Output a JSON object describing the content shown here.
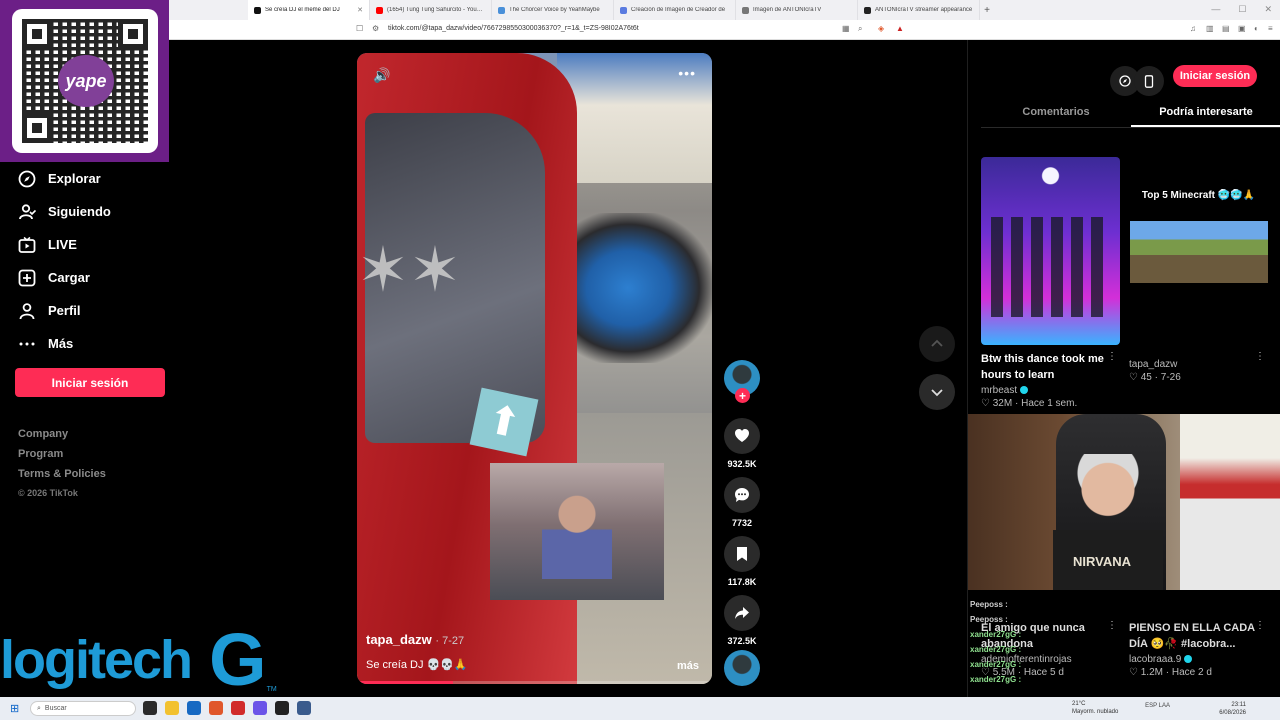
{
  "browser": {
    "tabs": [
      {
        "label": "Se creía DJ el meme del DJ",
        "color": "#111111",
        "active": true
      },
      {
        "label": "(1654) Tung Tung Sahurcito - YouTube",
        "color": "#ff0000",
        "active": false
      },
      {
        "label": "The Chorcer Voice by YeahMaybe",
        "color": "#4a90d9",
        "active": false
      },
      {
        "label": "Creación de Imagen de Creador de",
        "color": "#5a7be0",
        "active": false
      },
      {
        "label": "Imagen de ANTONIcraTV",
        "color": "#777777",
        "active": false
      },
      {
        "label": "ANTONIcraTV streamer appearance",
        "color": "#222222",
        "active": false
      }
    ],
    "url": "tiktok.com/@tapa_dazw/video/7667298550300036370?_r=1&_t=ZS-98I02A76t6t"
  },
  "sidebar": {
    "qr_brand": "yape",
    "items": [
      {
        "label": "Explorar",
        "icon": "compass-icon"
      },
      {
        "label": "Siguiendo",
        "icon": "user-follow-icon"
      },
      {
        "label": "LIVE",
        "icon": "live-tv-icon"
      },
      {
        "label": "Cargar",
        "icon": "upload-plus-icon"
      },
      {
        "label": "Perfil",
        "icon": "profile-icon"
      },
      {
        "label": "Más",
        "icon": "more-dots-icon"
      }
    ],
    "login_label": "Iniciar sesión",
    "footer": {
      "company": "Company",
      "program": "Program",
      "terms": "Terms & Policies",
      "copyright": "© 2026 TikTok"
    },
    "overlay_logo": "logitech",
    "overlay_logo_g": "G",
    "overlay_logo_tm": "TM"
  },
  "video": {
    "author": "tapa_dazw",
    "date": "· 7-27",
    "caption": "Se creía DJ 💀💀🙏",
    "more_label": "más",
    "progress": 0.27,
    "arrow_sign_glyph": "⬆"
  },
  "actions": {
    "likes": "932.5K",
    "comments": "7732",
    "saves": "117.8K",
    "shares": "372.5K"
  },
  "right_panel": {
    "login_label": "Iniciar sesión",
    "tabs": [
      "Comentarios",
      "Podría interesarte"
    ],
    "cards": [
      {
        "title": "Btw this dance took me hours to learn",
        "author": "mrbeast",
        "verified": true,
        "likes": "32M",
        "date": "Hace 1 sem."
      },
      {
        "overlay_title": "Top 5 Minecraft 🥶🥶🙏",
        "author": "tapa_dazw",
        "verified": false,
        "likes": "45",
        "date": "7-26"
      },
      {
        "title": "El amigo que nunca abandona",
        "author": "ademiofterentinrojas",
        "verified": false,
        "likes": "5.5M",
        "date": "Hace 5 d"
      },
      {
        "title": "PIENSO EN ELLA CADA DÍA 🥺🥀 #lacobra...",
        "author": "lacobraaa.9",
        "verified": true,
        "likes": "1.2M",
        "date": "Hace 2 d"
      }
    ],
    "webcam_shirt": "NIRVANA"
  },
  "chat": [
    {
      "user": "Peeposs :"
    },
    {
      "user": "Peeposs :"
    },
    {
      "user": "xander27gG :"
    },
    {
      "user": "xander27gG :"
    },
    {
      "user": "xander27gG :"
    },
    {
      "user": "xander27gG :"
    },
    {
      "user": "xander27gG :"
    }
  ],
  "taskbar": {
    "search_placeholder": "Buscar",
    "weather_temp": "21°C",
    "weather_desc": "Mayorm. nublado",
    "lang": "ESP LAA",
    "time": "23:11",
    "date": "6/08/2026"
  }
}
